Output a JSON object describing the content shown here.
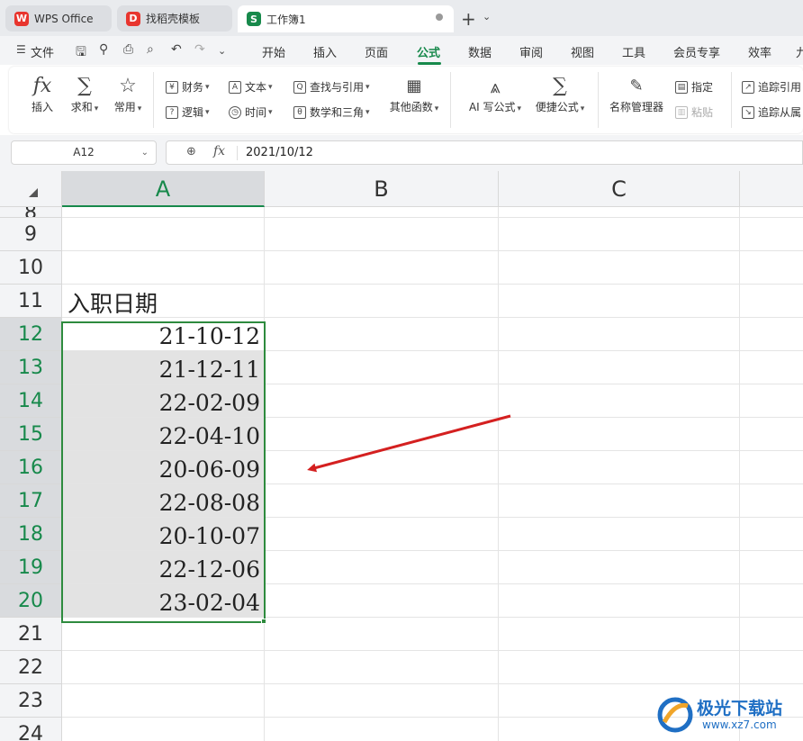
{
  "tabs": [
    {
      "label": "WPS Office",
      "logo": "W",
      "color": "#e8352e",
      "active": false
    },
    {
      "label": "找稻壳模板",
      "logo": "D",
      "color": "#e8352e",
      "active": false
    },
    {
      "label": "工作簿1",
      "logo": "S",
      "color": "#17894b",
      "active": true
    }
  ],
  "new_tab": "+",
  "menu": {
    "file": "文件",
    "items": [
      "开始",
      "插入",
      "页面",
      "公式",
      "数据",
      "审阅",
      "视图",
      "工具",
      "会员专享",
      "效率",
      "九"
    ],
    "active": "公式"
  },
  "ribbon": {
    "insert_fn": "插入",
    "sum": "求和",
    "common": "常用",
    "finance": "财务",
    "text": "文本",
    "lookup": "查找与引用",
    "other_fn": "其他函数",
    "logic": "逻辑",
    "time": "时间",
    "math": "数学和三角",
    "ai_formula": "AI 写公式",
    "quick_formula": "便捷公式",
    "name_manager": "名称管理器",
    "specify": "指定",
    "paste": "粘贴",
    "trace_precedents": "追踪引用",
    "trace_dependents": "追踪从属"
  },
  "formula_bar": {
    "name_box": "A12",
    "fx": "fx",
    "value": "2021/10/12"
  },
  "sheet": {
    "columns": [
      "A",
      "B",
      "C"
    ],
    "selected_column": "A",
    "rows": [
      {
        "n": "8",
        "a": ""
      },
      {
        "n": "9",
        "a": ""
      },
      {
        "n": "10",
        "a": ""
      },
      {
        "n": "11",
        "a": "入职日期"
      },
      {
        "n": "12",
        "a": "21-10-12"
      },
      {
        "n": "13",
        "a": "21-12-11"
      },
      {
        "n": "14",
        "a": "22-02-09"
      },
      {
        "n": "15",
        "a": "22-04-10"
      },
      {
        "n": "16",
        "a": "20-06-09"
      },
      {
        "n": "17",
        "a": "22-08-08"
      },
      {
        "n": "18",
        "a": "20-10-07"
      },
      {
        "n": "19",
        "a": "22-12-06"
      },
      {
        "n": "20",
        "a": "23-02-04"
      },
      {
        "n": "21",
        "a": ""
      },
      {
        "n": "22",
        "a": ""
      },
      {
        "n": "23",
        "a": ""
      },
      {
        "n": "24",
        "a": ""
      }
    ],
    "selected_range": "A12:A20"
  },
  "annotation_arrow_color": "#d42020",
  "watermark": {
    "name": "极光下载站",
    "url": "www.xz7.com"
  }
}
